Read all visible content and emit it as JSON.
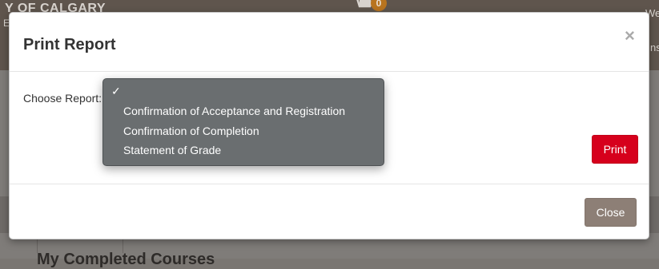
{
  "background": {
    "logo_text": "Y OF CALGARY",
    "logo_sub": "E",
    "cart_count": "0",
    "welcome_fragment": "We",
    "right_fragment": "ns",
    "heading_fragment": "My Completed Courses"
  },
  "modal": {
    "title": "Print Report",
    "close_symbol": "×",
    "choose_label": "Choose Report:",
    "print_label": "Print",
    "close_label": "Close"
  },
  "dropdown": {
    "check_symbol": "✓",
    "selected_index": 0,
    "options": [
      "",
      "Confirmation of Acceptance and Registration",
      "Confirmation of Completion",
      "Statement of Grade"
    ]
  }
}
